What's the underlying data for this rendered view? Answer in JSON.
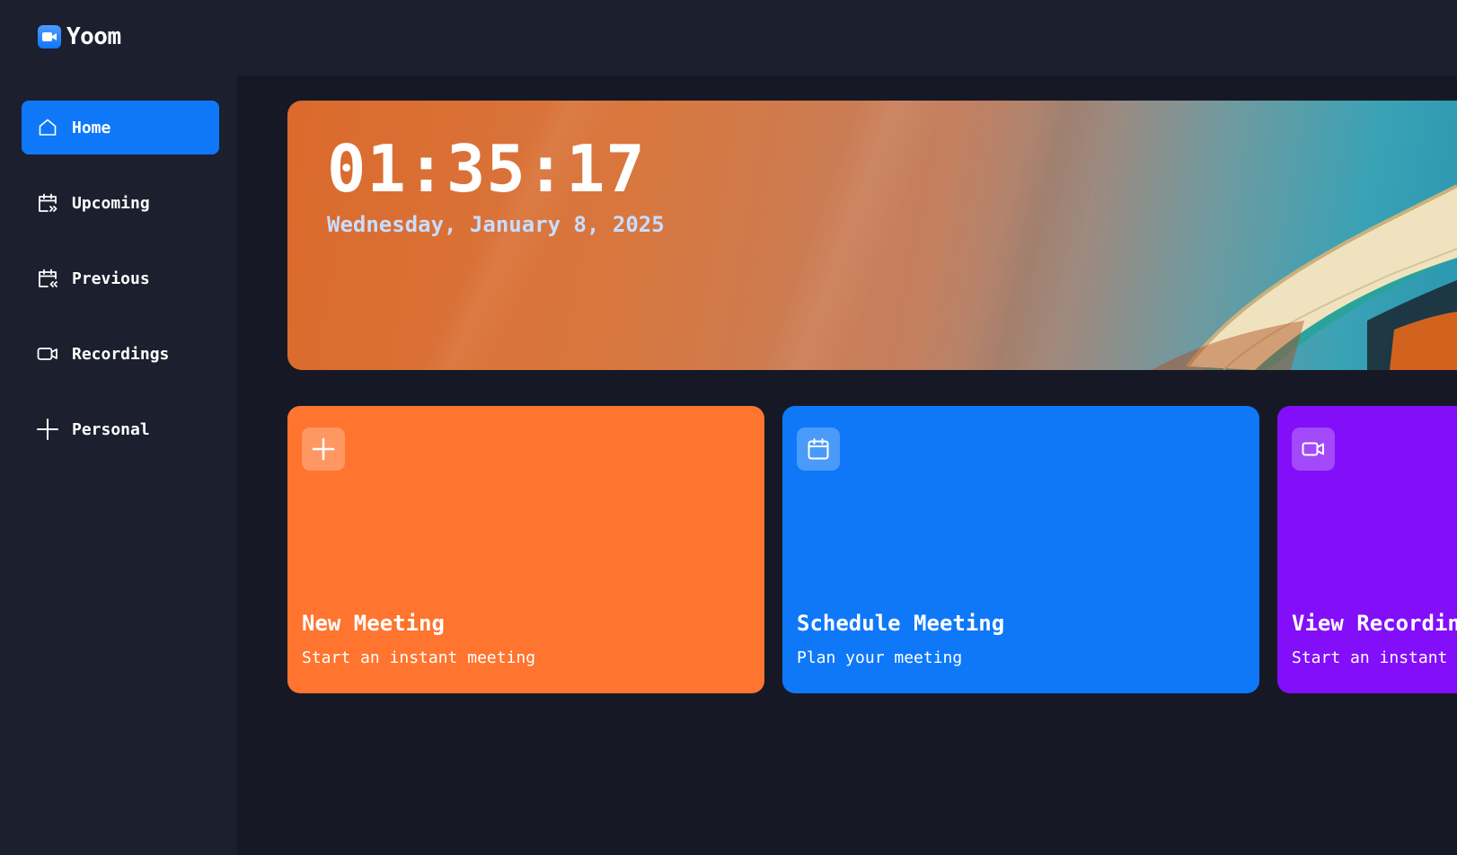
{
  "app": {
    "name": "Yoom"
  },
  "sidebar": {
    "items": [
      {
        "label": "Home",
        "icon": "home-icon",
        "active": true
      },
      {
        "label": "Upcoming",
        "icon": "calendar-forward-icon",
        "active": false
      },
      {
        "label": "Previous",
        "icon": "calendar-back-icon",
        "active": false
      },
      {
        "label": "Recordings",
        "icon": "video-icon",
        "active": false
      },
      {
        "label": "Personal",
        "icon": "plus-icon",
        "active": false
      }
    ]
  },
  "hero": {
    "time": "01:35:17",
    "date": "Wednesday, January 8, 2025"
  },
  "cards": [
    {
      "title": "New Meeting",
      "description": "Start an instant meeting",
      "icon": "plus-icon",
      "color": "#ff742e"
    },
    {
      "title": "Schedule Meeting",
      "description": "Plan your meeting",
      "icon": "calendar-icon",
      "color": "#0e78f9"
    },
    {
      "title": "View Recordings",
      "description": "Start an instant meeting",
      "icon": "video-icon",
      "color": "#830ef9"
    }
  ],
  "colors": {
    "background": "#161925",
    "panel": "#1c1f2e",
    "accent": "#0e78f9",
    "date_text": "#c9ddff"
  }
}
